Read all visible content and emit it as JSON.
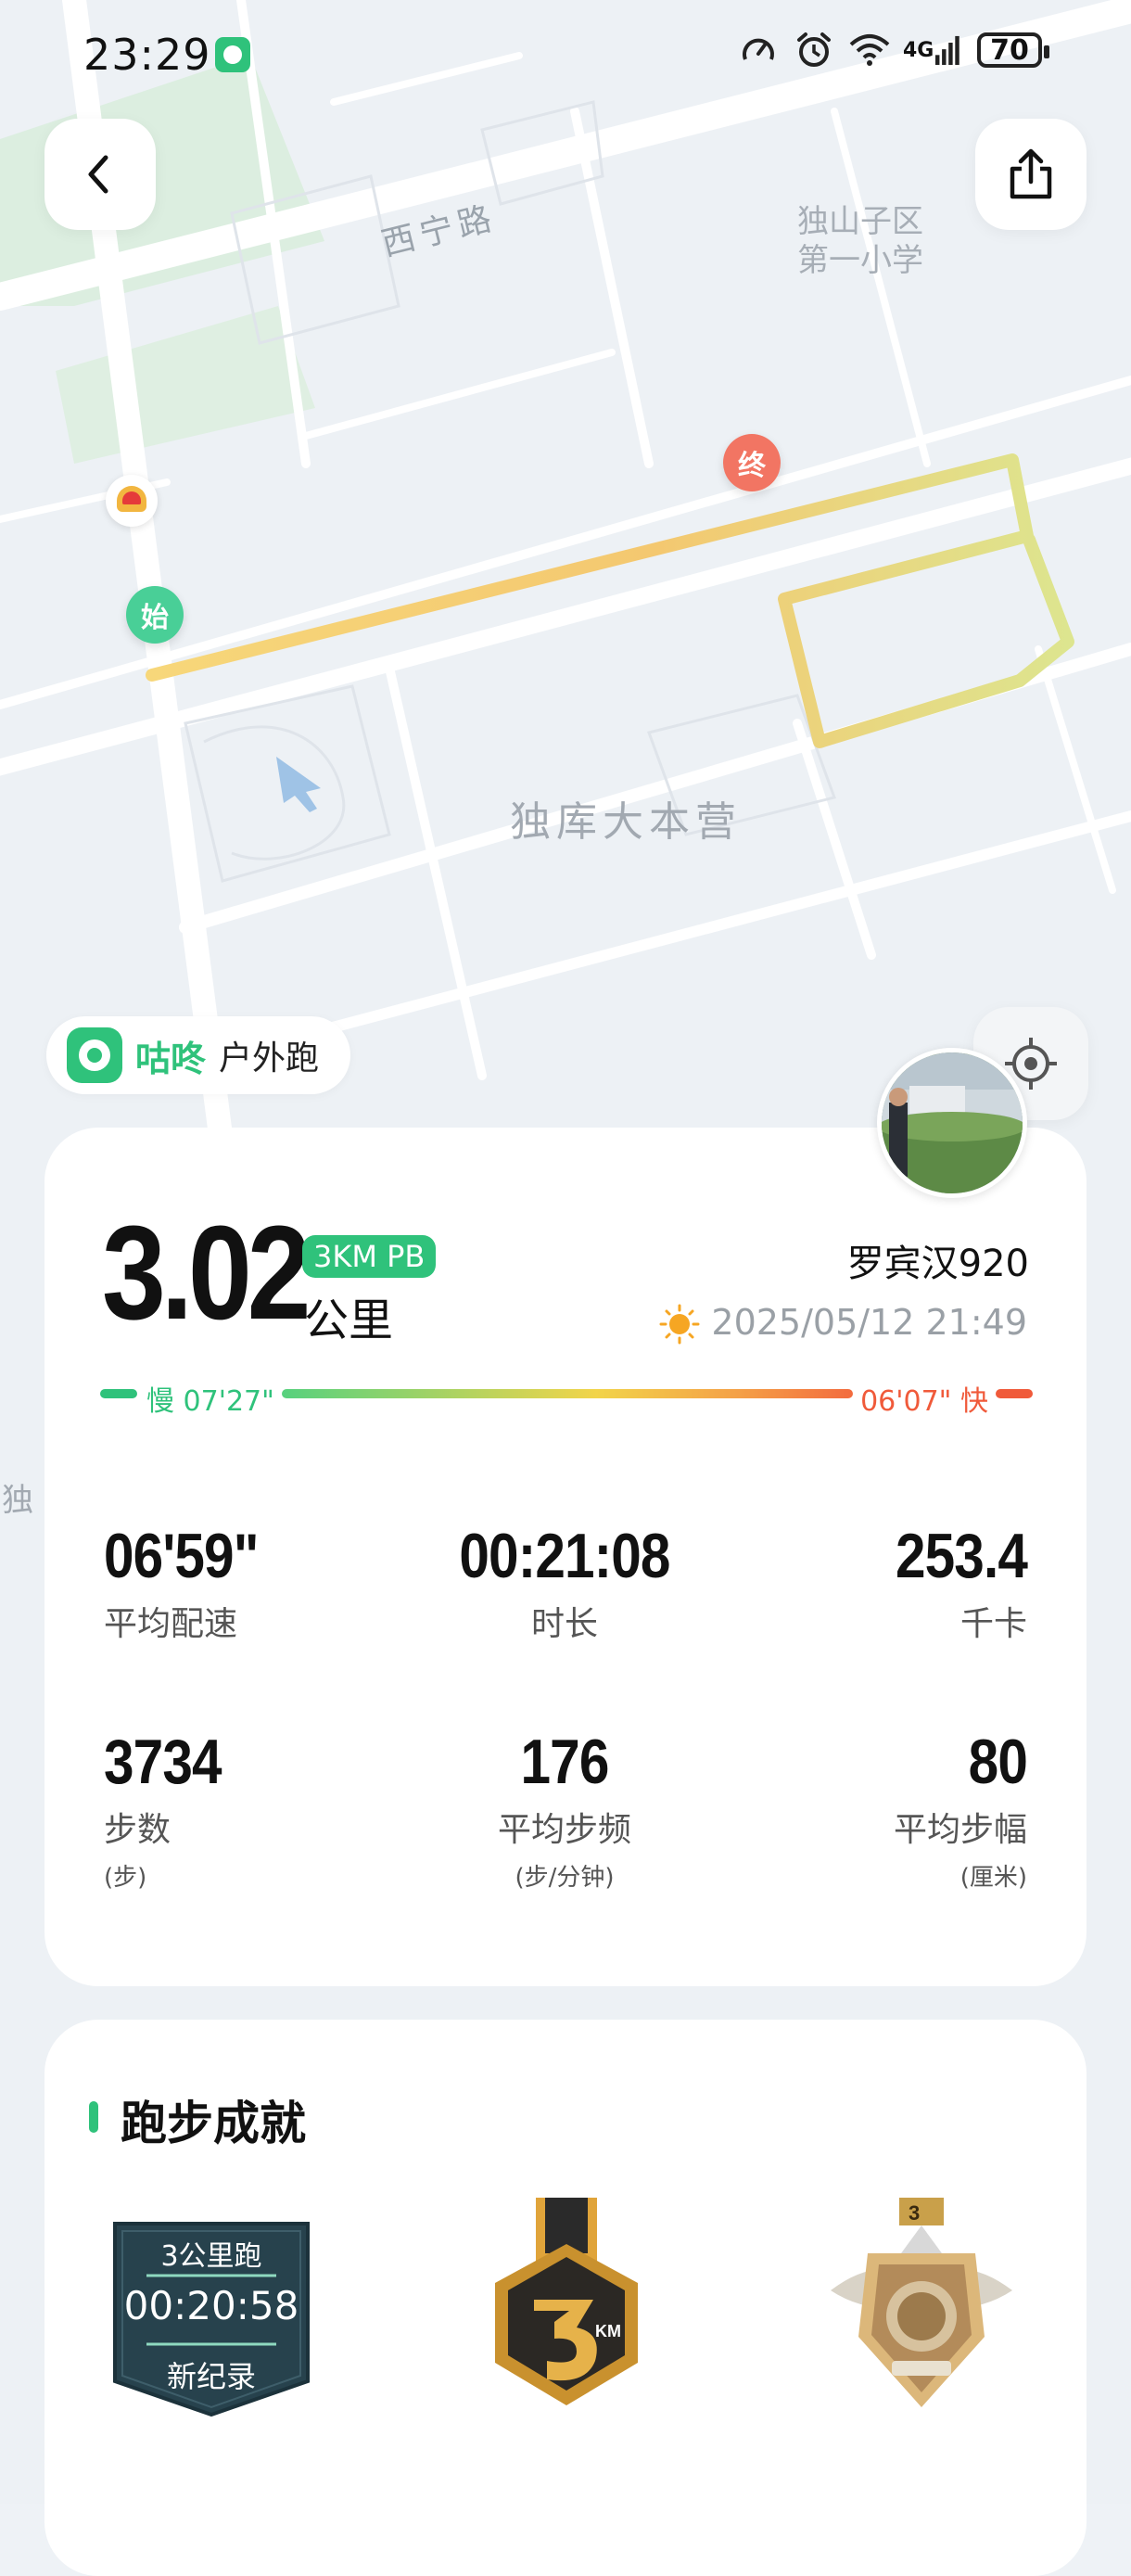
{
  "status_bar": {
    "time": "23:29",
    "battery": "70",
    "signal_label": "4G"
  },
  "map": {
    "road_label": "西宁路",
    "school_label_line1": "独山子区",
    "school_label_line2": "第一小学",
    "camp_label": "独库大本营",
    "edge_char": "独",
    "start_pin": "始",
    "end_pin": "终"
  },
  "brand": {
    "name": "咕咚",
    "mode": "户外跑"
  },
  "summary": {
    "distance": "3.02",
    "pb_badge": "3KM PB",
    "unit": "公里",
    "username": "罗宾汉920",
    "datetime": "2025/05/12 21:49",
    "pace_slow": "慢 07'27\"",
    "pace_fast": "06'07\" 快"
  },
  "stats": [
    {
      "value": "06'59\"",
      "label": "平均配速",
      "sub": ""
    },
    {
      "value": "00:21:08",
      "label": "时长",
      "sub": ""
    },
    {
      "value": "253.4",
      "label": "千卡",
      "sub": ""
    },
    {
      "value": "3734",
      "label": "步数",
      "sub": "(步)"
    },
    {
      "value": "176",
      "label": "平均步频",
      "sub": "(步/分钟)"
    },
    {
      "value": "80",
      "label": "平均步幅",
      "sub": "(厘米)"
    }
  ],
  "achievements": {
    "title": "跑步成就",
    "record_badge": {
      "title": "3公里跑",
      "time": "00:20:58",
      "caption": "新纪录"
    },
    "medal_3km_label": "KM",
    "medal_3km_number": "3"
  },
  "colors": {
    "brand_green": "#2fc27b",
    "fast_red": "#f05a3a",
    "route_yellow": "#dde58f"
  }
}
